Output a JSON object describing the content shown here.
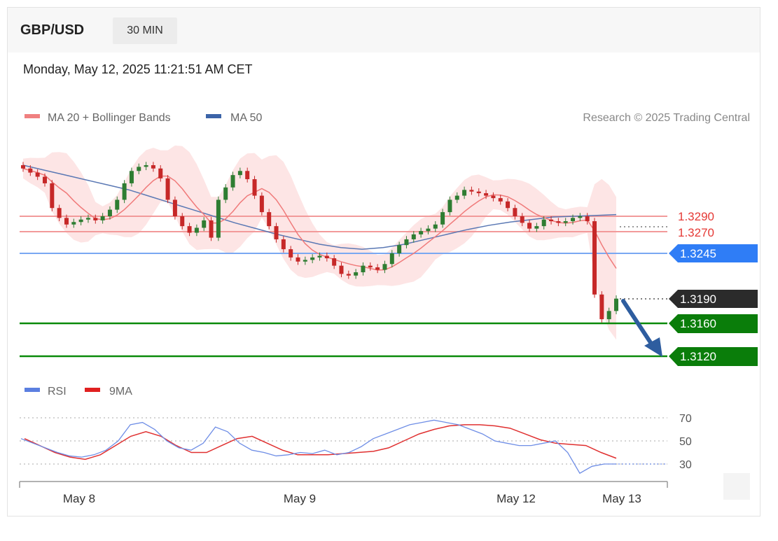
{
  "header": {
    "symbol": "GBP/USD",
    "timeframe": "30 MIN",
    "datetime": "Monday, May 12, 2025 11:21:51 AM CET"
  },
  "legend": {
    "ma20_label": "MA 20 + Bollinger Bands",
    "ma50_label": "MA 50",
    "ma20_color": "#f08080",
    "ma50_color": "#3c64a8",
    "credit": "Research © 2025 Trading Central"
  },
  "rsi_legend": {
    "rsi_label": "RSI",
    "ma9_label": "9MA",
    "rsi_color": "#5b7fe0",
    "ma9_color": "#e02020"
  },
  "chart_data": [
    {
      "type": "line",
      "title": "GBP/USD",
      "timeframe": "30 MIN",
      "x_tick_labels": [
        "May 8",
        "May 9",
        "May 12",
        "May 13"
      ],
      "levels": [
        {
          "label": "1.3290",
          "value": 1.329,
          "color": "#e53935",
          "style": "resistance"
        },
        {
          "label": "1.3270",
          "value": 1.327,
          "color": "#e53935",
          "style": "resistance"
        },
        {
          "label": "1.3245",
          "value": 1.3245,
          "color": "#2f7df6",
          "style": "pivot"
        },
        {
          "label": "1.3190",
          "value": 1.319,
          "color": "#2b2b2b",
          "style": "last-price"
        },
        {
          "label": "1.3160",
          "value": 1.316,
          "color": "#0a7d0a",
          "style": "support"
        },
        {
          "label": "1.3120",
          "value": 1.312,
          "color": "#0a7d0a",
          "style": "support"
        }
      ],
      "close_series": [
        1.3348,
        1.3343,
        1.3338,
        1.333,
        1.33,
        1.3288,
        1.328,
        1.3283,
        1.3286,
        1.3288,
        1.3285,
        1.329,
        1.3298,
        1.331,
        1.333,
        1.3345,
        1.335,
        1.3352,
        1.3348,
        1.3336,
        1.331,
        1.329,
        1.3278,
        1.327,
        1.3276,
        1.3285,
        1.3264,
        1.331,
        1.3325,
        1.334,
        1.3345,
        1.3335,
        1.3315,
        1.3295,
        1.3278,
        1.3262,
        1.325,
        1.324,
        1.3235,
        1.3237,
        1.324,
        1.3242,
        1.3239,
        1.323,
        1.322,
        1.3218,
        1.3222,
        1.323,
        1.3228,
        1.3225,
        1.3232,
        1.3245,
        1.3255,
        1.3262,
        1.3268,
        1.3272,
        1.3275,
        1.328,
        1.3295,
        1.331,
        1.3315,
        1.3322,
        1.332,
        1.3318,
        1.3315,
        1.3312,
        1.3308,
        1.33,
        1.329,
        1.3282,
        1.3275,
        1.3278,
        1.3286,
        1.3284,
        1.3282,
        1.3284,
        1.3288,
        1.329,
        1.3284,
        1.3195,
        1.3165,
        1.3175,
        1.319
      ],
      "ma50_series": [
        1.3352,
        1.3346,
        1.334,
        1.3334,
        1.3328,
        1.3322,
        1.3314,
        1.3306,
        1.3298,
        1.329,
        1.3282,
        1.3275,
        1.3268,
        1.3262,
        1.3256,
        1.3252,
        1.325,
        1.3252,
        1.3256,
        1.3262,
        1.3268,
        1.3274,
        1.3279,
        1.3283,
        1.3286,
        1.3289,
        1.329,
        1.3291,
        1.3292
      ],
      "rsi_series": [
        52,
        48,
        44,
        40,
        37,
        36,
        38,
        42,
        50,
        64,
        66,
        60,
        50,
        44,
        42,
        48,
        62,
        58,
        48,
        42,
        40,
        37,
        38,
        40,
        39,
        42,
        38,
        40,
        45,
        52,
        56,
        60,
        64,
        66,
        68,
        66,
        64,
        60,
        56,
        50,
        48,
        46,
        46,
        48,
        50,
        40,
        22,
        28,
        30,
        30
      ],
      "rsi_ma9_series": [
        52,
        46,
        40,
        36,
        34,
        38,
        46,
        54,
        58,
        54,
        46,
        40,
        40,
        46,
        52,
        54,
        48,
        42,
        38,
        38,
        38,
        39,
        40,
        41,
        44,
        50,
        56,
        60,
        63,
        64,
        64,
        63,
        61,
        56,
        51,
        48,
        47,
        46,
        40,
        35
      ],
      "rsi_levels": [
        70,
        50,
        30
      ],
      "ylabel": ""
    }
  ]
}
